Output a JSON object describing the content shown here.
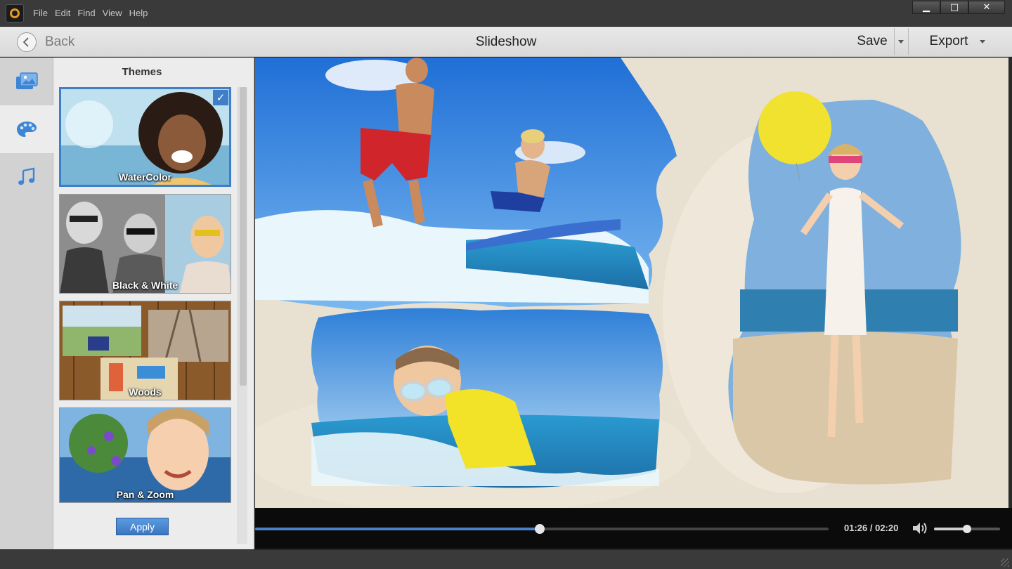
{
  "menu": {
    "items": [
      "File",
      "Edit",
      "Find",
      "View",
      "Help"
    ]
  },
  "window_controls": {
    "minimize": "▁",
    "maximize": "□",
    "close": "✕"
  },
  "toolbar": {
    "back_label": "Back",
    "title": "Slideshow",
    "save_label": "Save",
    "export_label": "Export"
  },
  "rail": {
    "items": [
      "media-icon",
      "palette-icon",
      "music-icon"
    ],
    "active": "palette-icon"
  },
  "themes": {
    "title": "Themes",
    "items": [
      {
        "label": "WaterColor",
        "selected": true
      },
      {
        "label": "Black & White",
        "selected": false
      },
      {
        "label": "Woods",
        "selected": false
      },
      {
        "label": "Pan & Zoom",
        "selected": false
      }
    ],
    "apply_label": "Apply"
  },
  "player": {
    "time": "01:26 / 02:20",
    "progress": 0.496,
    "volume": 0.5
  },
  "colors": {
    "accent": "#3e7fc7",
    "seek_fill": "#4b7fc8"
  }
}
